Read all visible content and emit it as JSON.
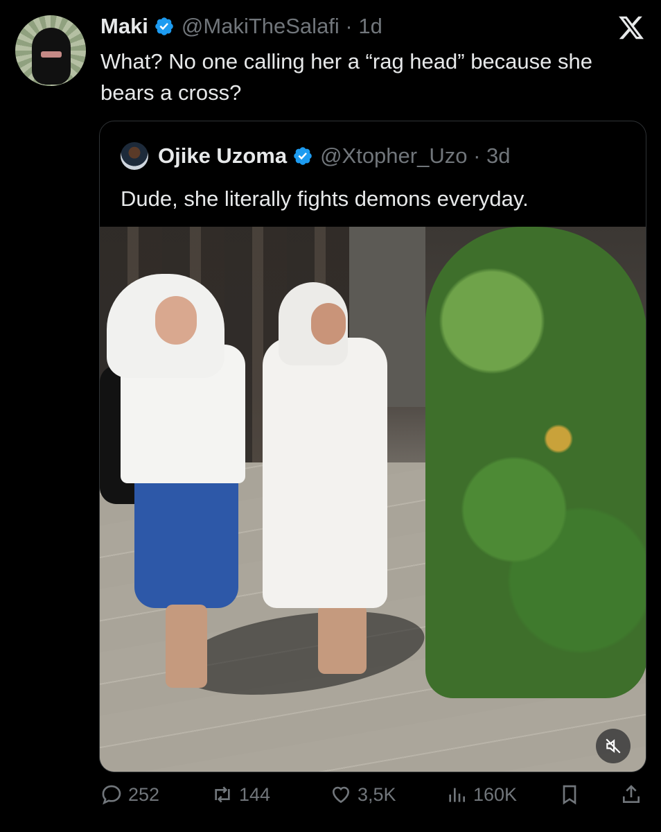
{
  "tweet": {
    "author_name": "Maki",
    "author_handle": "@MakiTheSalafi",
    "time": "1d",
    "text": "What? No one calling her a “rag head” because she bears a cross?"
  },
  "quoted_tweet": {
    "author_name": "Ojike Uzoma",
    "author_handle": "@Xtopher_Uzo",
    "time": "3d",
    "text": "Dude, she literally fights demons everyday."
  },
  "actions": {
    "replies": "252",
    "reposts": "144",
    "likes": "3,5K",
    "views": "160K"
  },
  "colors": {
    "background": "#000000",
    "text": "#e7e9ea",
    "secondary": "#71767b",
    "verified": "#1d9bf0",
    "border": "#2f3336"
  },
  "icons": [
    "x-logo-icon",
    "verified-badge-icon",
    "reply-icon",
    "repost-icon",
    "like-icon",
    "views-icon",
    "bookmark-icon",
    "share-icon",
    "mute-icon"
  ]
}
